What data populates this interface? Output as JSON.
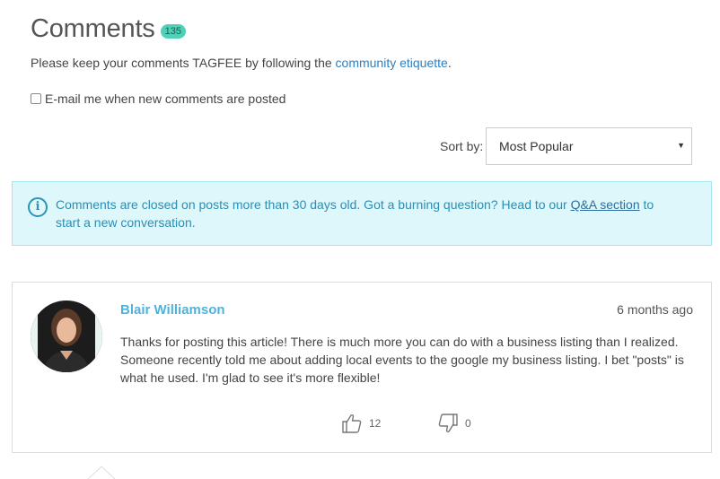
{
  "header": {
    "title": "Comments",
    "count": "135"
  },
  "intro": {
    "prefix": "Please keep your comments TAGFEE by following the",
    "link": "community etiquette",
    "suffix": "."
  },
  "email_option": {
    "label": "E-mail me when new comments are posted",
    "checked": false
  },
  "sort": {
    "label": "Sort by:",
    "selected": "Most Popular"
  },
  "notice": {
    "icon": "info-icon",
    "text_before": "Comments are closed on posts more than 30 days old. Got a burning question? Head to our",
    "link": "Q&A section",
    "text_after": "to start a new conversation."
  },
  "comments": [
    {
      "author": "Blair Williamson",
      "time": "6 months ago",
      "body": "Thanks for posting this article! There is much more you can do with a business listing than I realized. Someone recently told me about adding local events to the google my business listing. I bet \"posts\" is what he used. I'm glad to see it's more flexible!",
      "upvotes": "12",
      "downvotes": "0"
    }
  ],
  "colors": {
    "badge": "#4fd1b7",
    "link": "#2f7fbf",
    "author": "#4db3dd",
    "notice_bg": "#ddf7fa",
    "notice_border": "#a6e6ee"
  }
}
